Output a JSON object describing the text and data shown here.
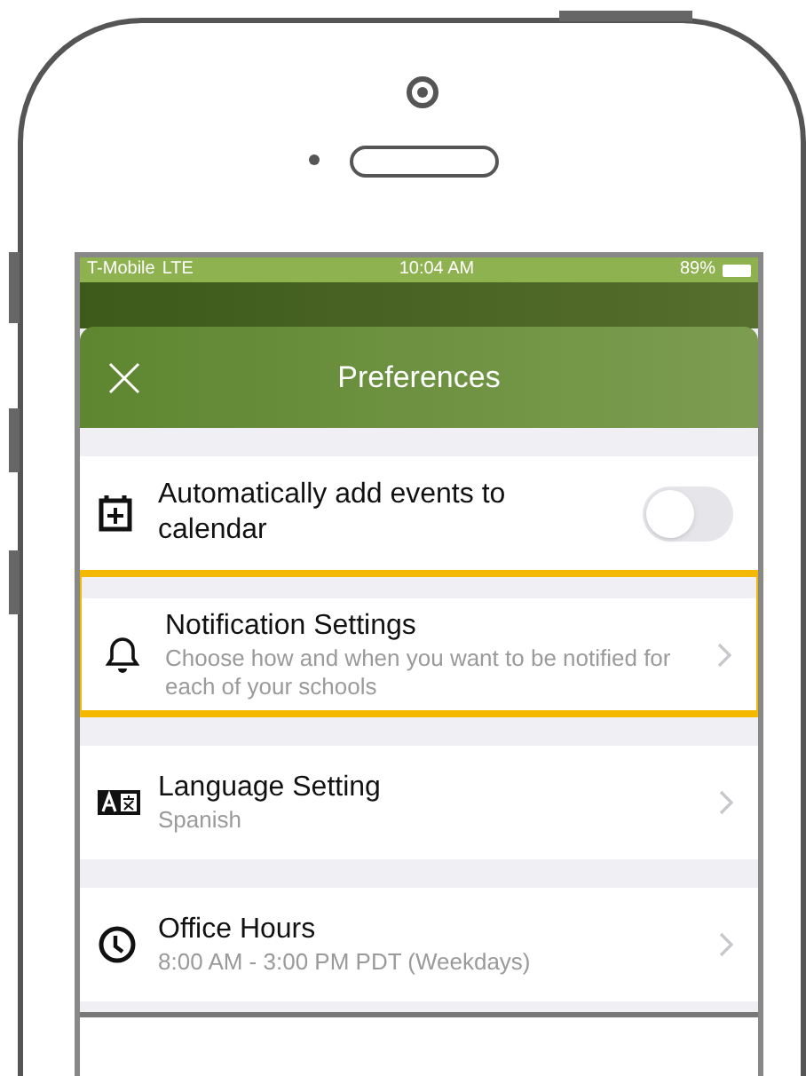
{
  "status_bar": {
    "carrier": "T-Mobile",
    "network": "LTE",
    "time": "10:04 AM",
    "battery": "89%"
  },
  "header": {
    "title": "Preferences"
  },
  "settings": [
    {
      "kind": "toggle",
      "title": "Automatically add events to calendar",
      "on": false,
      "highlighted": false
    },
    {
      "kind": "link",
      "title": "Notification Settings",
      "subtitle": "Choose how and when you want to be notified for each of your schools",
      "highlighted": true
    },
    {
      "kind": "link",
      "title": "Language Setting",
      "subtitle": "Spanish",
      "highlighted": false
    },
    {
      "kind": "link",
      "title": "Office Hours",
      "subtitle": "8:00 AM - 3:00 PM PDT (Weekdays)",
      "highlighted": false
    }
  ]
}
